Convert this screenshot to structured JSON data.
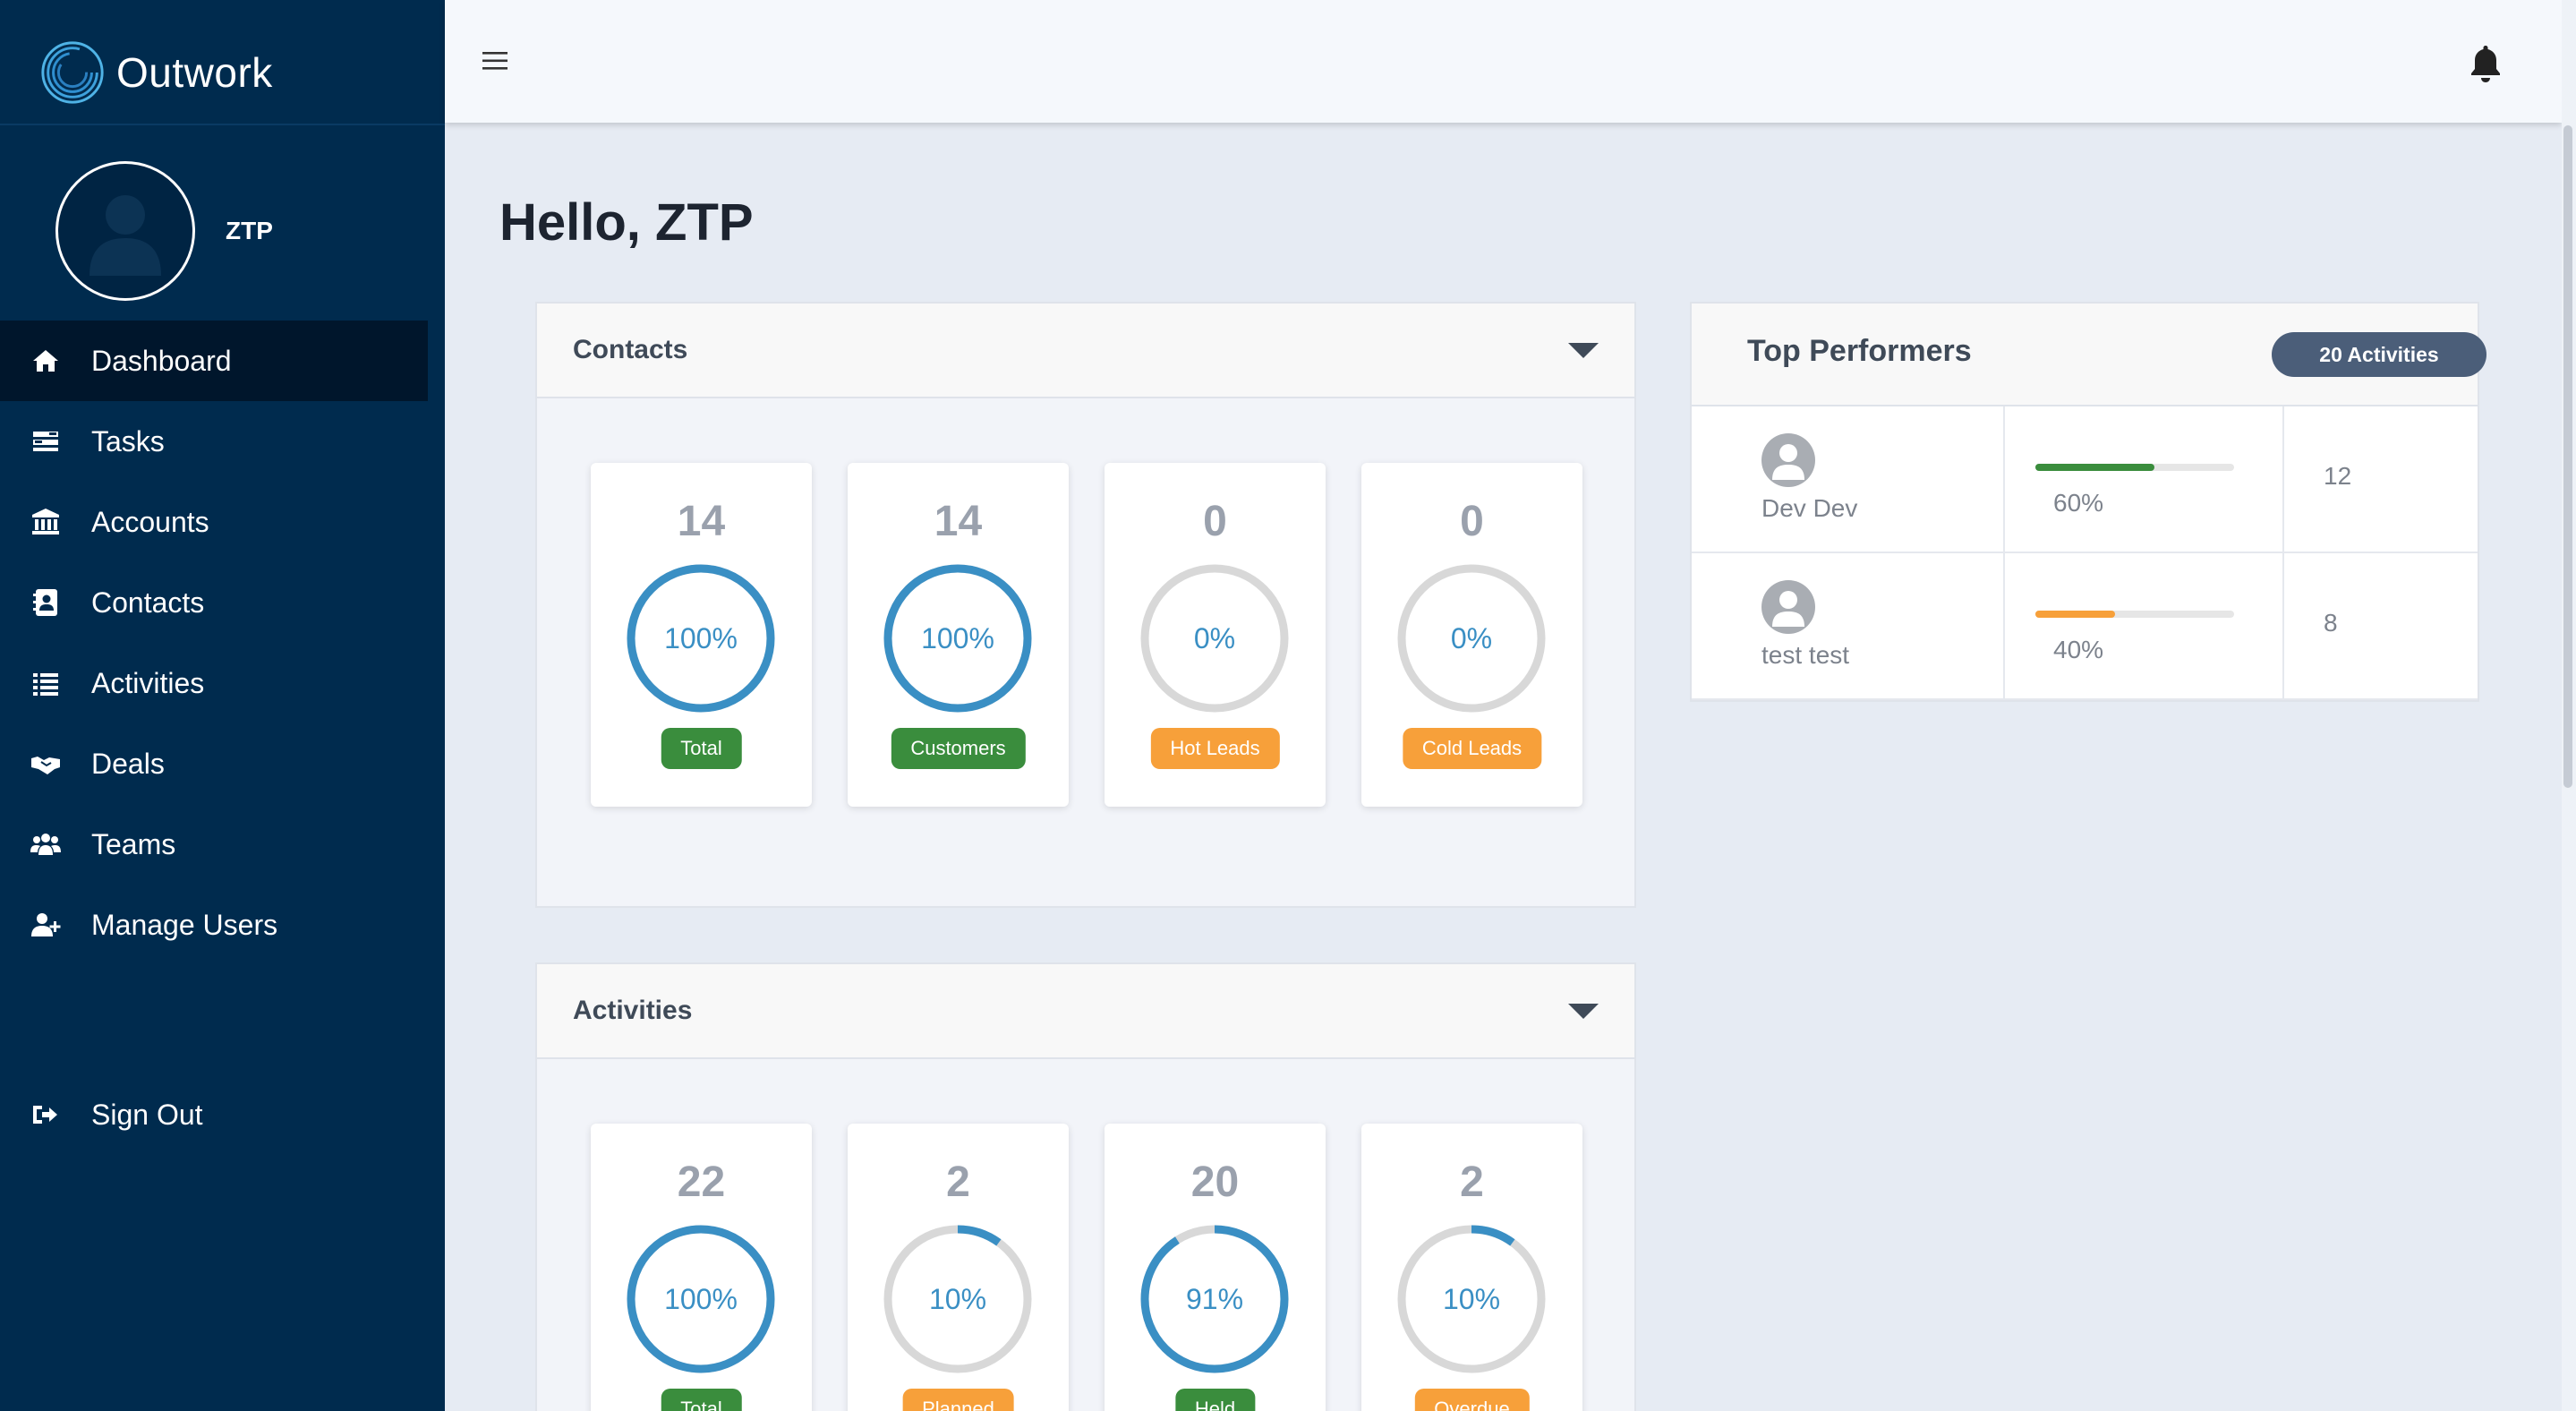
{
  "brand": {
    "name": "Outwork"
  },
  "user": {
    "name": "ZTP"
  },
  "nav": {
    "items": [
      {
        "label": "Dashboard",
        "icon": "home-icon",
        "active": true
      },
      {
        "label": "Tasks",
        "icon": "tasks-icon"
      },
      {
        "label": "Accounts",
        "icon": "bank-icon"
      },
      {
        "label": "Contacts",
        "icon": "address-book-icon"
      },
      {
        "label": "Activities",
        "icon": "list-icon"
      },
      {
        "label": "Deals",
        "icon": "handshake-icon"
      },
      {
        "label": "Teams",
        "icon": "users-icon"
      },
      {
        "label": "Manage Users",
        "icon": "user-plus-icon"
      }
    ],
    "signout": "Sign Out"
  },
  "greeting": "Hello, ZTP",
  "contacts_panel": {
    "title": "Contacts",
    "cards": [
      {
        "count": "14",
        "percent": "100%",
        "progress": 1.0,
        "label": "Total",
        "badge_color": "#3a8d3d"
      },
      {
        "count": "14",
        "percent": "100%",
        "progress": 1.0,
        "label": "Customers",
        "badge_color": "#3a8d3d"
      },
      {
        "count": "0",
        "percent": "0%",
        "progress": 0.0,
        "label": "Hot Leads",
        "badge_color": "#f7a03a"
      },
      {
        "count": "0",
        "percent": "0%",
        "progress": 0.0,
        "label": "Cold Leads",
        "badge_color": "#f7a03a"
      }
    ]
  },
  "activities_panel": {
    "title": "Activities",
    "cards": [
      {
        "count": "22",
        "percent": "100%",
        "progress": 1.0,
        "label": "Total",
        "badge_color": "#3a8d3d"
      },
      {
        "count": "2",
        "percent": "10%",
        "progress": 0.1,
        "label": "Planned",
        "badge_color": "#f7a03a"
      },
      {
        "count": "20",
        "percent": "91%",
        "progress": 0.91,
        "label": "Held",
        "badge_color": "#3a8d3d"
      },
      {
        "count": "2",
        "percent": "10%",
        "progress": 0.1,
        "label": "Overdue",
        "badge_color": "#f7a03a"
      }
    ]
  },
  "top_performers": {
    "title": "Top Performers",
    "badge": "20 Activities",
    "rows": [
      {
        "name": "Dev Dev",
        "percent": "60%",
        "progress": 0.6,
        "bar_color": "#3a8d3d",
        "count": "12"
      },
      {
        "name": "test test",
        "percent": "40%",
        "progress": 0.4,
        "bar_color": "#f7a03a",
        "count": "8"
      }
    ]
  },
  "colors": {
    "sidebar": "#002b4e",
    "ring_active": "#3a8fc4",
    "ring_track": "#d8d8d8"
  }
}
